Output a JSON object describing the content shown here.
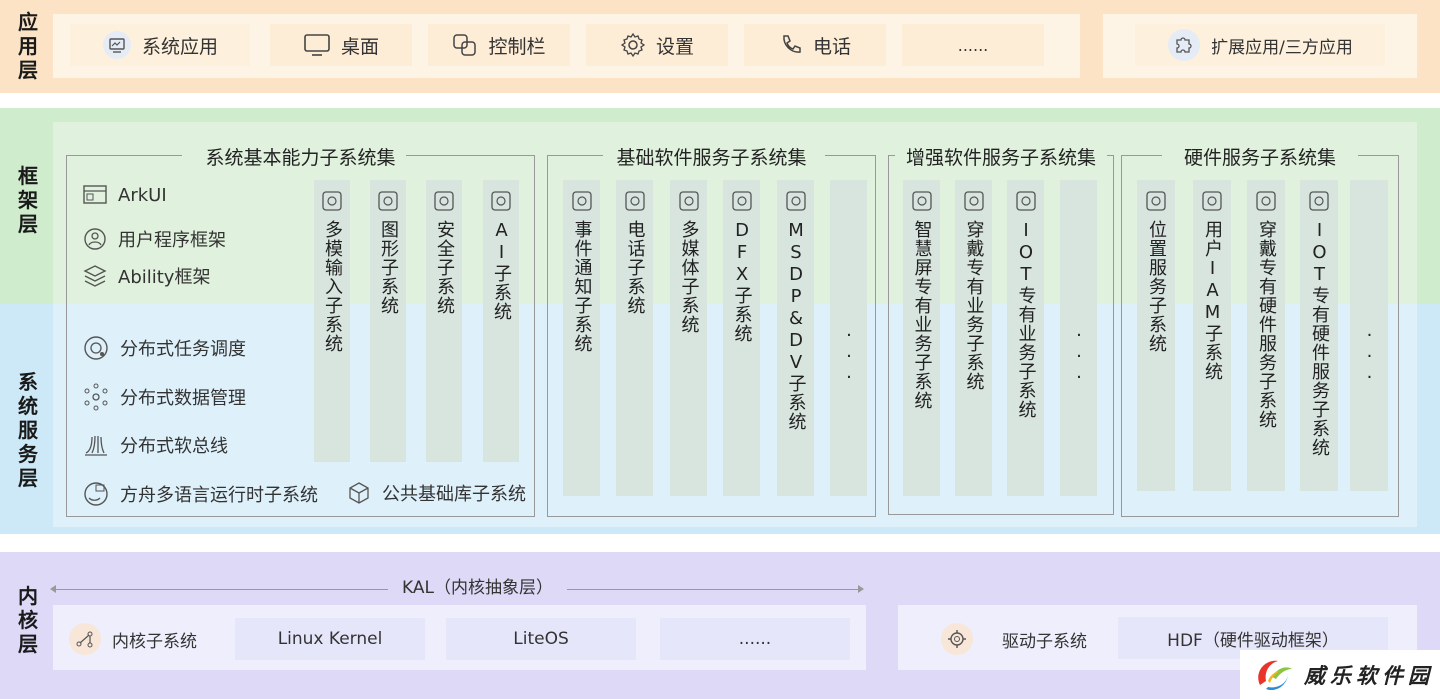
{
  "layers": {
    "app": "应用层",
    "framework": "框架层",
    "system_service": "系统服务层",
    "kernel": "内核层"
  },
  "app_layer": {
    "items": [
      {
        "label": "系统应用",
        "icon": "system-app-icon"
      },
      {
        "label": "桌面",
        "icon": "desktop-icon"
      },
      {
        "label": "控制栏",
        "icon": "control-bar-icon"
      },
      {
        "label": "设置",
        "icon": "settings-gear-icon"
      },
      {
        "label": "电话",
        "icon": "phone-icon"
      },
      {
        "label": "......",
        "icon": ""
      }
    ],
    "extension": {
      "label": "扩展应用/三方应用",
      "icon": "puzzle-icon"
    }
  },
  "groups": {
    "basic": {
      "title": "系统基本能力子系统集",
      "features": [
        {
          "label": "ArkUI",
          "icon": "arkui-icon"
        },
        {
          "label": "用户程序框架",
          "icon": "user-program-icon"
        },
        {
          "label": "Ability框架",
          "icon": "ability-layers-icon"
        },
        {
          "label": "分布式任务调度",
          "icon": "distributed-task-icon"
        },
        {
          "label": "分布式数据管理",
          "icon": "distributed-data-icon"
        },
        {
          "label": "分布式软总线",
          "icon": "soft-bus-icon"
        },
        {
          "label": "方舟多语言运行时子系统",
          "icon": "ark-runtime-icon"
        },
        {
          "label": "公共基础库子系统",
          "icon": "common-lib-icon"
        }
      ],
      "columns": [
        {
          "label": "多模输入子系统",
          "icon": "input-icon"
        },
        {
          "label": "图形子系统",
          "icon": "graphics-icon"
        },
        {
          "label": "安全子系统",
          "icon": "key-icon"
        },
        {
          "label": "AI子系统",
          "icon": "ai-icon"
        }
      ]
    },
    "software": {
      "title": "基础软件服务子系统集",
      "columns": [
        {
          "label": "事件通知子系统",
          "icon": "notification-icon"
        },
        {
          "label": "电话子系统",
          "icon": "telephony-icon"
        },
        {
          "label": "多媒体子系统",
          "icon": "media-icon"
        },
        {
          "label": "DFX子系统",
          "icon": "dfx-icon"
        },
        {
          "label": "MSDP&DV子系统",
          "icon": "msdp-icon"
        },
        {
          "label": "...",
          "icon": ""
        }
      ]
    },
    "enhanced": {
      "title": "增强软件服务子系统集",
      "columns": [
        {
          "label": "智慧屏专有业务子系统",
          "icon": "smart-screen-icon"
        },
        {
          "label": "穿戴专有业务子系统",
          "icon": "wearable-icon"
        },
        {
          "label": "IOT专有业务子系统",
          "icon": "iot-icon"
        },
        {
          "label": "...",
          "icon": ""
        }
      ]
    },
    "hardware": {
      "title": "硬件服务子系统集",
      "columns": [
        {
          "label": "位置服务子系统",
          "icon": "location-icon"
        },
        {
          "label": "用户IAM子系统",
          "icon": "iam-eye-icon"
        },
        {
          "label": "穿戴专有硬件服务子系统",
          "icon": "wearable-hw-icon"
        },
        {
          "label": "IOT专有硬件服务子系统",
          "icon": "iot-hw-icon"
        },
        {
          "label": "...",
          "icon": ""
        }
      ]
    }
  },
  "kernel_layer": {
    "kal_label": "KAL（内核抽象层）",
    "kernel_subsystem": "内核子系统",
    "kernels": [
      "Linux Kernel",
      "LiteOS",
      "......"
    ],
    "driver_subsystem": "驱动子系统",
    "hdf": "HDF（硬件驱动框架）"
  },
  "watermark": "威乐软件园",
  "colors": {
    "app_band": "#fce3c6",
    "framework_band": "#cfeccd",
    "system_band": "#cde9f7",
    "kernel_band": "#ddd9f6"
  }
}
